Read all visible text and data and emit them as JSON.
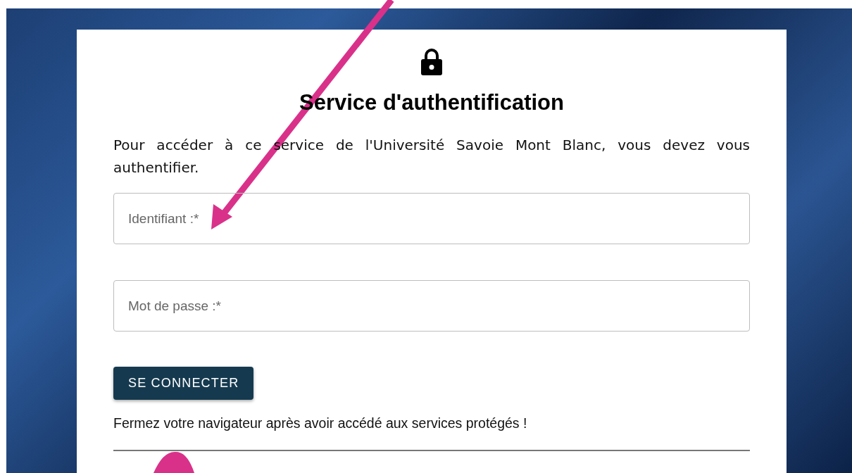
{
  "title": "Service d'authentification",
  "intro": "Pour accéder à ce service de l'Université Savoie Mont Blanc, vous devez vous authentifier.",
  "fields": [
    {
      "placeholder": "Identifiant :*"
    },
    {
      "placeholder": "Mot de passe :*"
    }
  ],
  "submit_button": "SE CONNECTER",
  "notice": "Fermez votre navigateur après avoir accédé aux services protégés !"
}
